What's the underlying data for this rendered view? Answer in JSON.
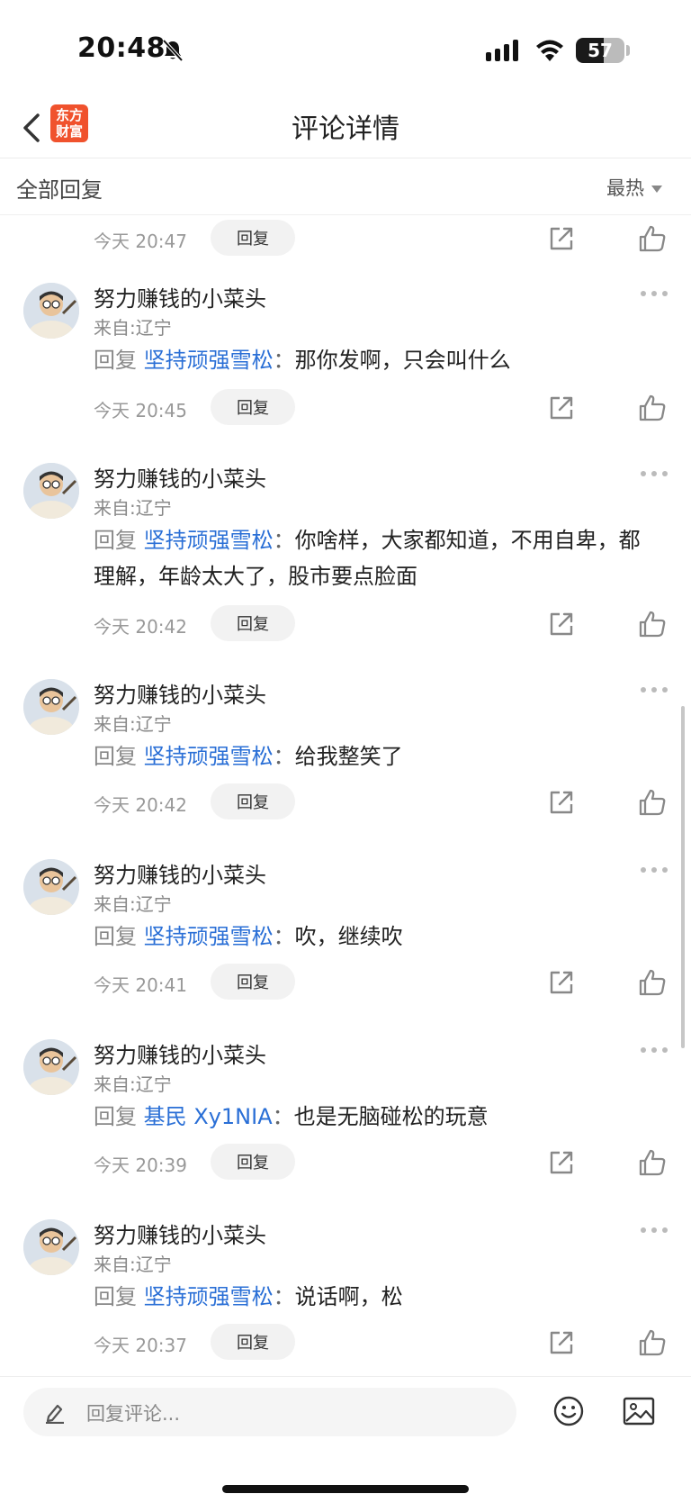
{
  "status_bar": {
    "time": "20:48",
    "battery": "57",
    "battery_level": 0.57
  },
  "header": {
    "logo_text": "东方财富",
    "logo_line1": "东方",
    "logo_line2": "财富",
    "title": "评论详情"
  },
  "section": {
    "title": "全部回复",
    "sort_label": "最热"
  },
  "first_item": {
    "time": "今天 20:47",
    "reply_label": "回复"
  },
  "comments": [
    {
      "username": "努力赚钱的小菜头",
      "location": "来自:辽宁",
      "prefix": "回复",
      "target": "坚持顽强雪松",
      "separator": "：",
      "text": "那你发啊，只会叫什么",
      "time": "今天 20:45",
      "reply_label": "回复"
    },
    {
      "username": "努力赚钱的小菜头",
      "location": "来自:辽宁",
      "prefix": "回复",
      "target": "坚持顽强雪松",
      "separator": "：",
      "text": "你啥样，大家都知道，不用自卑，都理解，年龄太大了，股市要点脸面",
      "time": "今天 20:42",
      "reply_label": "回复"
    },
    {
      "username": "努力赚钱的小菜头",
      "location": "来自:辽宁",
      "prefix": "回复",
      "target": "坚持顽强雪松",
      "separator": "：",
      "text": "给我整笑了",
      "time": "今天 20:42",
      "reply_label": "回复"
    },
    {
      "username": "努力赚钱的小菜头",
      "location": "来自:辽宁",
      "prefix": "回复",
      "target": "坚持顽强雪松",
      "separator": "：",
      "text": "吹，继续吹",
      "time": "今天 20:41",
      "reply_label": "回复"
    },
    {
      "username": "努力赚钱的小菜头",
      "location": "来自:辽宁",
      "prefix": "回复",
      "target": "基民 Xy1NIA",
      "separator": "：",
      "text": "也是无脑碰松的玩意",
      "time": "今天 20:39",
      "reply_label": "回复"
    },
    {
      "username": "努力赚钱的小菜头",
      "location": "来自:辽宁",
      "prefix": "回复",
      "target": "坚持顽强雪松",
      "separator": "：",
      "text": "说话啊，松",
      "time": "今天 20:37",
      "reply_label": "回复"
    }
  ],
  "bottom_bar": {
    "placeholder": "回复评论..."
  },
  "colors": {
    "brand": "#f0522d",
    "link": "#2a6fd6"
  },
  "icons": [
    "back-icon",
    "bell-off-icon",
    "signal-icon",
    "wifi-icon",
    "more-icon",
    "share-icon",
    "like-icon",
    "pencil-icon",
    "emoji-icon",
    "image-icon"
  ]
}
